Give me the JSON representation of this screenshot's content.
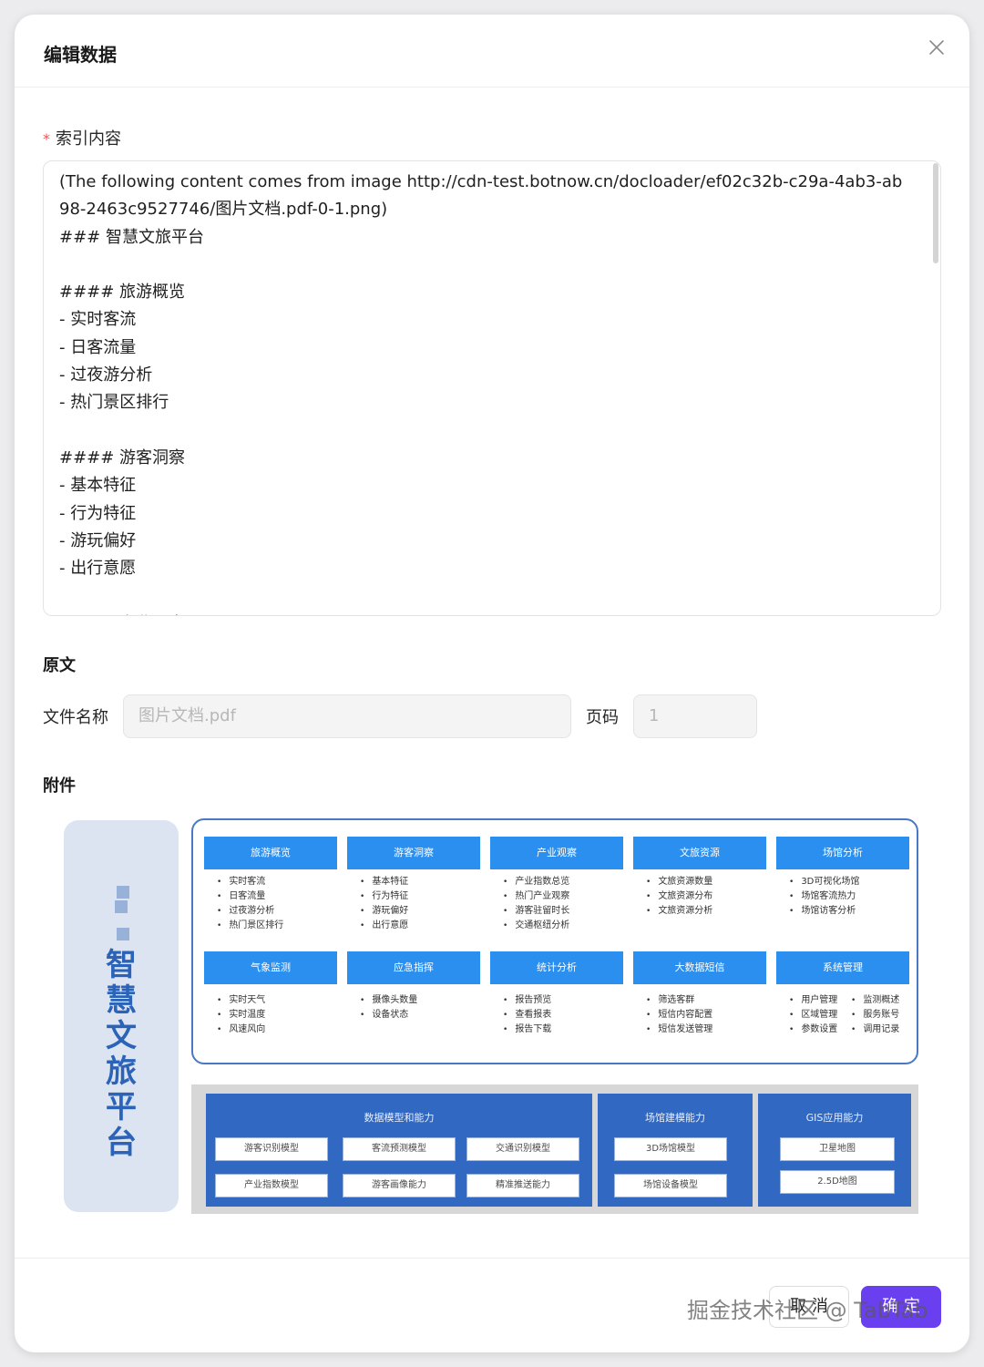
{
  "dialog": {
    "title": "编辑数据",
    "cancel": "取 消",
    "confirm": "确 定"
  },
  "index_field": {
    "required_mark": "*",
    "label": "索引内容",
    "value": "(The following content comes from image http://cdn-test.botnow.cn/docloader/ef02c32b-c29a-4ab3-ab98-2463c9527746/图片文档.pdf-0-1.png)\n### 智慧文旅平台\n\n#### 旅游概览\n- 实时客流\n- 日客流量\n- 过夜游分析\n- 热门景区排行\n\n#### 游客洞察\n- 基本特征\n- 行为特征\n- 游玩偏好\n- 出行意愿\n\n#### 产业观察"
  },
  "source": {
    "section_title": "原文",
    "file_label": "文件名称",
    "file_value": "图片文档.pdf",
    "page_label": "页码",
    "page_value": "1"
  },
  "attachment": {
    "section_title": "附件",
    "side_title": [
      "智",
      "慧",
      "文",
      "旅",
      "平",
      "台"
    ],
    "modules_row1": [
      {
        "title": "旅游概览",
        "items": [
          "实时客流",
          "日客流量",
          "过夜游分析",
          "热门景区排行"
        ]
      },
      {
        "title": "游客洞察",
        "items": [
          "基本特征",
          "行为特征",
          "游玩偏好",
          "出行意愿"
        ]
      },
      {
        "title": "产业观察",
        "items": [
          "产业指数总览",
          "热门产业观察",
          "游客驻留时长",
          "交通枢纽分析"
        ]
      },
      {
        "title": "文旅资源",
        "items": [
          "文旅资源数量",
          "文旅资源分布",
          "文旅资源分析"
        ]
      },
      {
        "title": "场馆分析",
        "items": [
          "3D可视化场馆",
          "场馆客流热力",
          "场馆访客分析"
        ]
      }
    ],
    "modules_row2": [
      {
        "title": "气象监测",
        "items": [
          "实时天气",
          "实时温度",
          "风速风向"
        ]
      },
      {
        "title": "应急指挥",
        "items": [
          "摄像头数量",
          "设备状态"
        ]
      },
      {
        "title": "统计分析",
        "items": [
          "报告预览",
          "查看报表",
          "报告下载"
        ]
      },
      {
        "title": "大数据短信",
        "items": [
          "筛选客群",
          "短信内容配置",
          "短信发送管理"
        ]
      },
      {
        "title": "系统管理",
        "items": [
          "用户管理",
          "监测概述",
          "区域管理",
          "服务账号",
          "参数设置",
          "调用记录"
        ]
      }
    ],
    "capabilities": {
      "data_model": {
        "title": "数据模型和能力",
        "items": [
          "游客识别模型",
          "客流预测模型",
          "交通识别模型",
          "产业指数模型",
          "游客画像能力",
          "精准推送能力"
        ]
      },
      "venue": {
        "title": "场馆建模能力",
        "items": [
          "3D场馆模型",
          "场馆设备模型"
        ]
      },
      "gis": {
        "title": "GIS应用能力",
        "items": [
          "卫星地图",
          "2.5D地图"
        ]
      }
    }
  },
  "watermark": "掘金技术社区 @ TabTab",
  "colors": {
    "primary": "#6a3ff0",
    "module_blue": "#2b8ff0",
    "capability_blue": "#3169c2"
  }
}
